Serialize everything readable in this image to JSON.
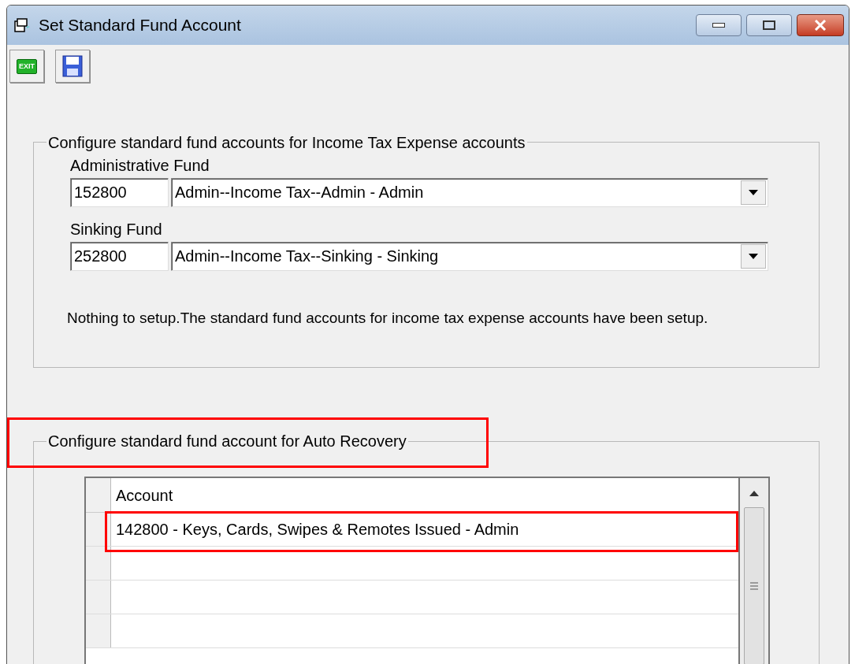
{
  "window": {
    "title": "Set Standard Fund Account"
  },
  "toolbar": [
    {
      "kind": "exit",
      "label": "EXIT"
    },
    {
      "kind": "save"
    }
  ],
  "income_tax_group": {
    "title": "Configure standard fund accounts for Income Tax Expense accounts",
    "funds": [
      {
        "label": "Administrative Fund",
        "code": "152800",
        "account": "Admin--Income Tax--Admin - Admin"
      },
      {
        "label": "Sinking Fund",
        "code": "252800",
        "account": "Admin--Income Tax--Sinking - Sinking"
      }
    ],
    "message": "Nothing to setup.The standard fund accounts for income tax expense accounts have been setup."
  },
  "auto_recovery_group": {
    "title": "Configure standard fund account for Auto Recovery",
    "highlighted": true,
    "table": {
      "columns": [
        "Account"
      ],
      "rows": [
        {
          "account": "142800 - Keys, Cards, Swipes & Remotes Issued - Admin",
          "highlighted": true
        }
      ]
    }
  }
}
